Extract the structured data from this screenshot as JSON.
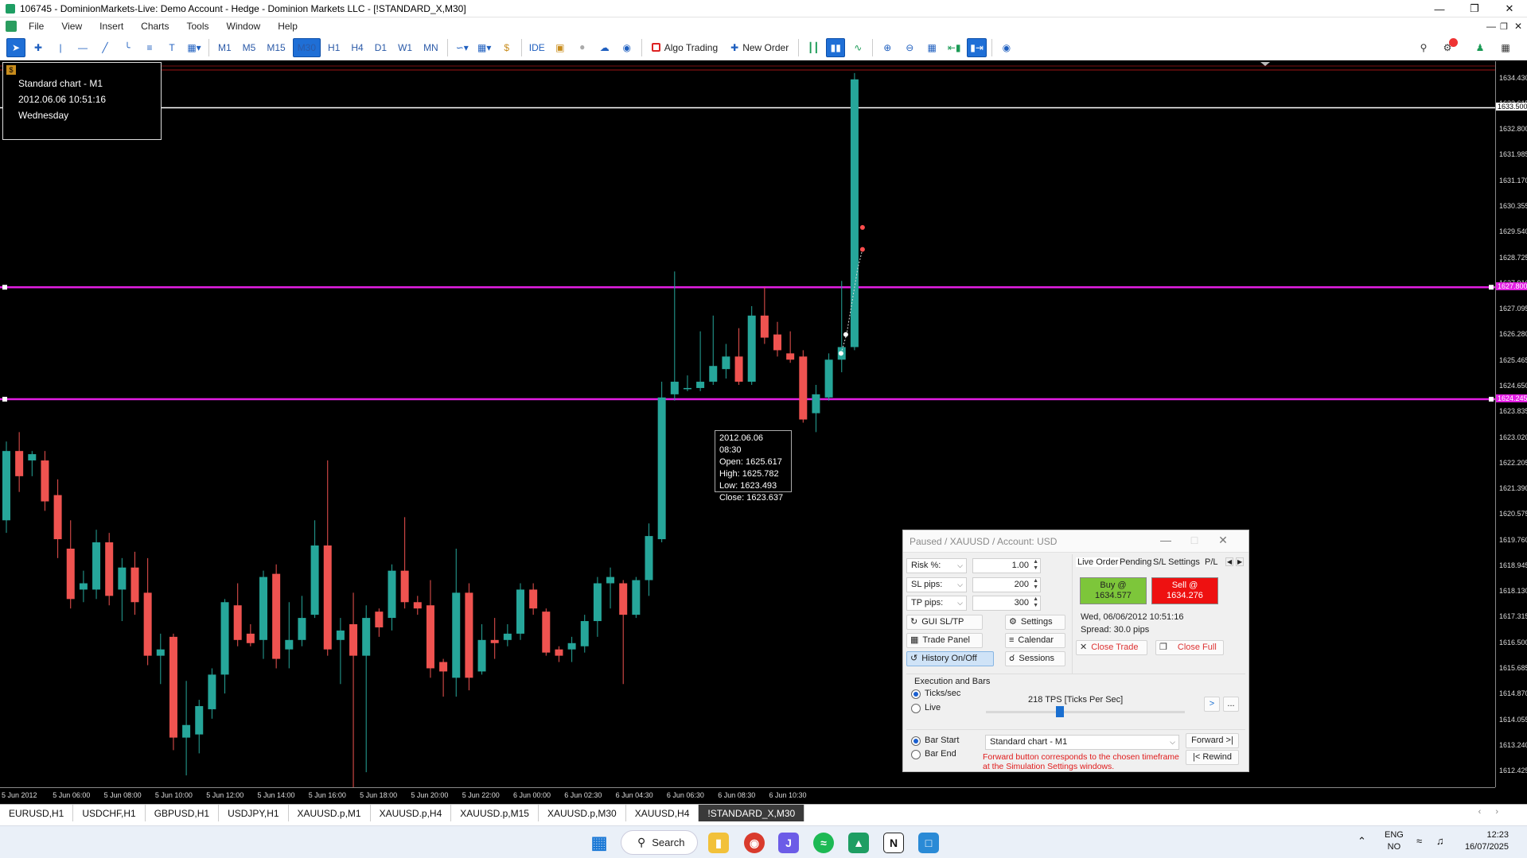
{
  "window": {
    "title": "106745 - DominionMarkets-Live: Demo Account - Hedge - Dominion Markets LLC - [!STANDARD_X,M30]",
    "controls": [
      "—",
      "❐",
      "✕"
    ]
  },
  "menu": [
    "File",
    "View",
    "Insert",
    "Charts",
    "Tools",
    "Window",
    "Help"
  ],
  "toolbar": {
    "timeframes": [
      "M1",
      "M5",
      "M15",
      "M30",
      "H1",
      "H4",
      "D1",
      "W1",
      "MN"
    ],
    "active_timeframe": "M30",
    "ide_label": "IDE",
    "algo_trading_label": "Algo Trading",
    "new_order_label": "New Order"
  },
  "info_box": {
    "line1": "Standard chart - M1",
    "line2": "2012.06.06 10:51:16",
    "line3": "Wednesday"
  },
  "tooltip": {
    "time": "2012.06.06 08:30",
    "open": "Open: 1625.617",
    "high": "High: 1625.782",
    "low": "Low: 1623.493",
    "close": "Close: 1623.637"
  },
  "price_axis": {
    "labels": [
      "1634.430",
      "1633.615",
      "1632.800",
      "1631.985",
      "1631.170",
      "1630.355",
      "1629.540",
      "1628.725",
      "1627.910",
      "1627.095",
      "1626.280",
      "1625.465",
      "1624.650",
      "1623.835",
      "1623.020",
      "1622.205",
      "1621.390",
      "1620.575",
      "1619.760",
      "1618.945",
      "1618.130",
      "1617.315",
      "1616.500",
      "1615.685",
      "1614.870",
      "1614.055",
      "1613.240",
      "1612.425"
    ],
    "tag_white": "1633.500",
    "tag_magenta_top": "1627.800",
    "tag_magenta_bottom": "1624.245"
  },
  "time_axis": {
    "labels": [
      "5 Jun 2012",
      "5 Jun 06:00",
      "5 Jun 08:00",
      "5 Jun 10:00",
      "5 Jun 12:00",
      "5 Jun 14:00",
      "5 Jun 16:00",
      "5 Jun 18:00",
      "5 Jun 20:00",
      "5 Jun 22:00",
      "6 Jun 00:00",
      "6 Jun 02:30",
      "6 Jun 04:30",
      "6 Jun 06:30",
      "6 Jun 08:30",
      "6 Jun 10:30"
    ]
  },
  "colors": {
    "bull": "#26a69a",
    "bear": "#ef5350",
    "magenta": "#e21ee2",
    "sell_red": "#ee1111",
    "buy_green": "#7dc63a"
  },
  "chart_data": {
    "type": "candlestick",
    "ylim": [
      1612.0,
      1634.9
    ],
    "levels": {
      "white": 1633.5,
      "magenta_top": 1627.8,
      "magenta_bottom": 1624.245
    },
    "candles": [
      [
        1620.4,
        1622.6,
        1620.0,
        1622.9
      ],
      [
        1622.6,
        1621.8,
        1621.3,
        1623.2
      ],
      [
        1622.3,
        1622.5,
        1621.8,
        1622.6
      ],
      [
        1622.3,
        1621.0,
        1620.7,
        1622.6
      ],
      [
        1621.2,
        1619.8,
        1619.2,
        1621.7
      ],
      [
        1619.5,
        1617.9,
        1617.6,
        1620.4
      ],
      [
        1618.2,
        1618.4,
        1617.8,
        1618.8
      ],
      [
        1618.2,
        1619.7,
        1617.9,
        1620.1
      ],
      [
        1619.7,
        1618.0,
        1617.7,
        1620.0
      ],
      [
        1618.2,
        1618.9,
        1617.2,
        1619.2
      ],
      [
        1618.9,
        1617.8,
        1617.4,
        1619.4
      ],
      [
        1618.1,
        1616.1,
        1615.8,
        1619.2
      ],
      [
        1616.1,
        1616.3,
        1615.2,
        1616.8
      ],
      [
        1616.7,
        1613.5,
        1613.1,
        1616.8
      ],
      [
        1613.5,
        1613.9,
        1612.3,
        1615.3
      ],
      [
        1613.6,
        1614.5,
        1613.0,
        1614.7
      ],
      [
        1614.4,
        1615.5,
        1614.1,
        1615.7
      ],
      [
        1615.5,
        1617.8,
        1614.9,
        1617.9
      ],
      [
        1617.7,
        1616.6,
        1616.4,
        1618.4
      ],
      [
        1616.8,
        1616.5,
        1616.4,
        1617.1
      ],
      [
        1616.6,
        1618.6,
        1616.0,
        1618.8
      ],
      [
        1618.7,
        1616.0,
        1615.7,
        1619.0
      ],
      [
        1616.3,
        1616.6,
        1615.7,
        1617.8
      ],
      [
        1616.6,
        1617.3,
        1616.4,
        1618.0
      ],
      [
        1617.4,
        1619.6,
        1617.3,
        1620.4
      ],
      [
        1619.6,
        1616.3,
        1616.1,
        1622.3
      ],
      [
        1616.6,
        1616.9,
        1615.2,
        1617.3
      ],
      [
        1617.1,
        1616.1,
        1611.8,
        1618.1
      ],
      [
        1616.1,
        1617.3,
        1612.4,
        1617.7
      ],
      [
        1617.5,
        1617.0,
        1616.7,
        1617.6
      ],
      [
        1617.3,
        1618.8,
        1616.9,
        1619.0
      ],
      [
        1618.8,
        1617.8,
        1617.6,
        1620.5
      ],
      [
        1617.8,
        1617.6,
        1617.4,
        1618.0
      ],
      [
        1617.7,
        1615.7,
        1615.4,
        1618.5
      ],
      [
        1615.9,
        1615.6,
        1614.8,
        1616.0
      ],
      [
        1615.4,
        1618.1,
        1614.8,
        1619.5
      ],
      [
        1618.1,
        1615.4,
        1615.0,
        1618.4
      ],
      [
        1615.6,
        1616.6,
        1615.5,
        1617.1
      ],
      [
        1616.6,
        1616.5,
        1616.0,
        1617.3
      ],
      [
        1616.6,
        1616.8,
        1616.4,
        1617.1
      ],
      [
        1616.8,
        1618.2,
        1616.6,
        1618.4
      ],
      [
        1618.2,
        1617.6,
        1617.4,
        1618.4
      ],
      [
        1617.5,
        1616.2,
        1616.1,
        1617.6
      ],
      [
        1616.3,
        1616.1,
        1615.9,
        1616.4
      ],
      [
        1616.3,
        1616.5,
        1615.9,
        1616.7
      ],
      [
        1616.4,
        1617.2,
        1616.2,
        1617.4
      ],
      [
        1617.2,
        1618.4,
        1616.7,
        1618.6
      ],
      [
        1618.4,
        1618.6,
        1617.6,
        1618.9
      ],
      [
        1618.4,
        1617.4,
        1615.2,
        1618.5
      ],
      [
        1617.4,
        1618.5,
        1617.3,
        1618.6
      ],
      [
        1618.5,
        1619.9,
        1618.0,
        1620.3
      ],
      [
        1619.8,
        1624.3,
        1619.7,
        1624.8
      ],
      [
        1624.4,
        1624.8,
        1624.2,
        1628.3
      ],
      [
        1624.6,
        1624.6,
        1624.5,
        1625.0
      ],
      [
        1624.6,
        1624.8,
        1624.5,
        1626.4
      ],
      [
        1624.8,
        1625.3,
        1624.7,
        1626.9
      ],
      [
        1625.2,
        1625.6,
        1624.9,
        1626.0
      ],
      [
        1625.6,
        1624.8,
        1624.7,
        1626.5
      ],
      [
        1624.8,
        1626.9,
        1624.7,
        1627.2
      ],
      [
        1626.9,
        1626.2,
        1626.0,
        1627.8
      ],
      [
        1626.3,
        1625.8,
        1625.6,
        1626.7
      ],
      [
        1625.7,
        1625.5,
        1625.4,
        1626.4
      ],
      [
        1625.6,
        1623.6,
        1623.5,
        1625.8
      ],
      [
        1623.8,
        1624.4,
        1623.2,
        1624.7
      ],
      [
        1624.3,
        1625.5,
        1624.2,
        1625.7
      ],
      [
        1625.5,
        1625.9,
        1625.1,
        1628.0
      ],
      [
        1625.9,
        1634.4,
        1625.8,
        1634.6
      ]
    ]
  },
  "tabs": [
    "EURUSD,H1",
    "USDCHF,H1",
    "GBPUSD,H1",
    "USDJPY,H1",
    "XAUUSD.p,M1",
    "XAUUSD.p,H4",
    "XAUUSD.p,M15",
    "XAUUSD.p,M30",
    "XAUUSD,H4",
    "!STANDARD_X,M30"
  ],
  "active_tab": "!STANDARD_X,M30",
  "panel": {
    "title": "Paused / XAUUSD / Account: USD",
    "risk_label": "Risk %:",
    "risk_value": "1.00",
    "sl_label": "SL pips:",
    "sl_value": "200",
    "tp_label": "TP pips:",
    "tp_value": "300",
    "gui_sltp": "GUI SL/TP",
    "settings": "Settings",
    "trade_panel": "Trade Panel",
    "calendar": "Calendar",
    "history": "History On/Off",
    "sessions": "Sessions",
    "tabs": [
      "Live Order",
      "Pending",
      "S/L Settings",
      "P/L"
    ],
    "buy_line1": "Buy @",
    "buy_line2": "1634.577",
    "sell_line1": "Sell @",
    "sell_line2": "1634.276",
    "datetime": "Wed, 06/06/2012  10:51:16",
    "spread": "Spread: 30.0 pips",
    "close_trade": "Close Trade",
    "close_full": "Close Full",
    "exec_title": "Execution and Bars",
    "ticks_sec": "Ticks/sec",
    "live": "Live",
    "tps_text": "218 TPS [Ticks Per Sec]",
    "play_btn": ">",
    "more_btn": "...",
    "bar_start": "Bar Start",
    "bar_end": "Bar End",
    "chart_select": "Standard chart - M1",
    "forward": "Forward >|",
    "rewind": "|< Rewind",
    "note": "Forward button corresponds to the chosen timeframe at the Simulation Settings windows."
  },
  "taskbar": {
    "search_label": "Search",
    "lang1": "ENG",
    "lang2": "NO",
    "time": "12:23",
    "date": "16/07/2025"
  }
}
